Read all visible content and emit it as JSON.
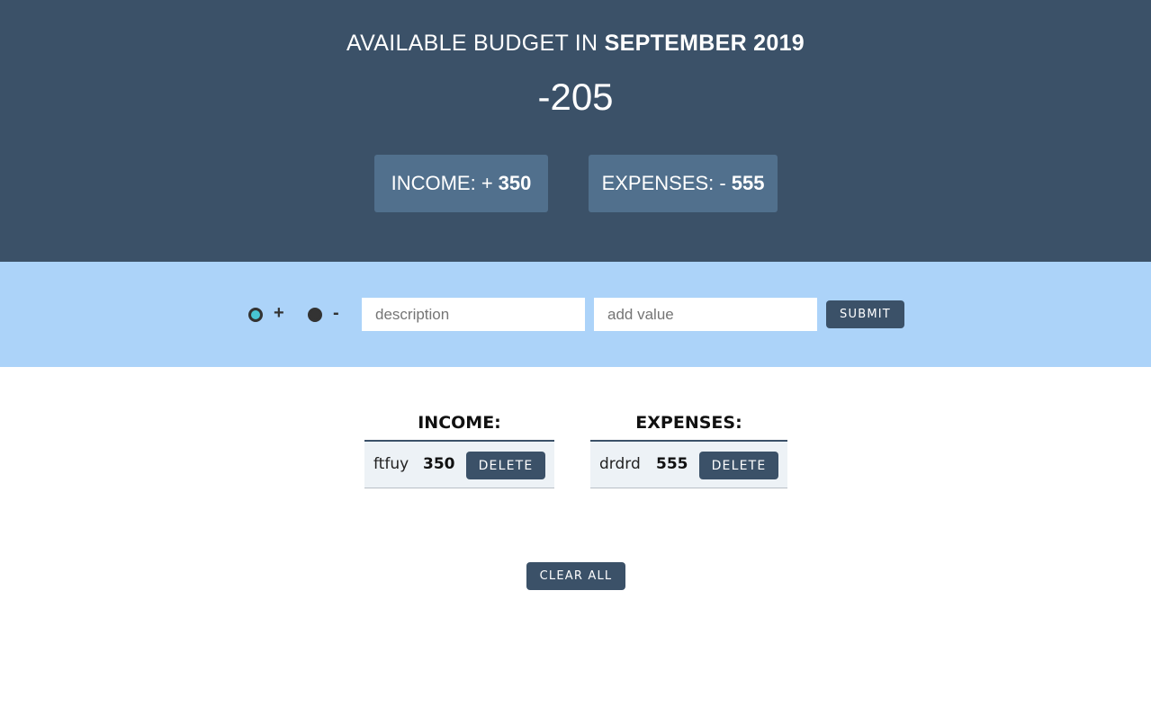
{
  "header": {
    "title_prefix": "AVAILABLE BUDGET IN",
    "title_month": "SEPTEMBER 2019",
    "budget": "-205",
    "income_label": "INCOME: +",
    "income_value": "350",
    "expenses_label": "EXPENSES: -",
    "expenses_value": "555"
  },
  "form": {
    "type_plus_label": "+",
    "type_minus_label": "-",
    "description_placeholder": "description",
    "value_placeholder": "add value",
    "submit_label": "SUBMIT"
  },
  "income": {
    "title": "INCOME:",
    "items": [
      {
        "description": "ftfuy",
        "value": "350",
        "delete_label": "DELETE"
      }
    ]
  },
  "expenses": {
    "title": "EXPENSES:",
    "items": [
      {
        "description": "drdrd",
        "value": "555",
        "delete_label": "DELETE"
      }
    ]
  },
  "clear_all_label": "CLEAR ALL",
  "colors": {
    "header_bg": "#3b5168",
    "summary_box_bg": "#51708d",
    "add_bar_bg": "#acd3f9",
    "radio_selected": "#48c5d2",
    "button_bg": "#3b5168",
    "row_bg": "#edf2f6"
  }
}
